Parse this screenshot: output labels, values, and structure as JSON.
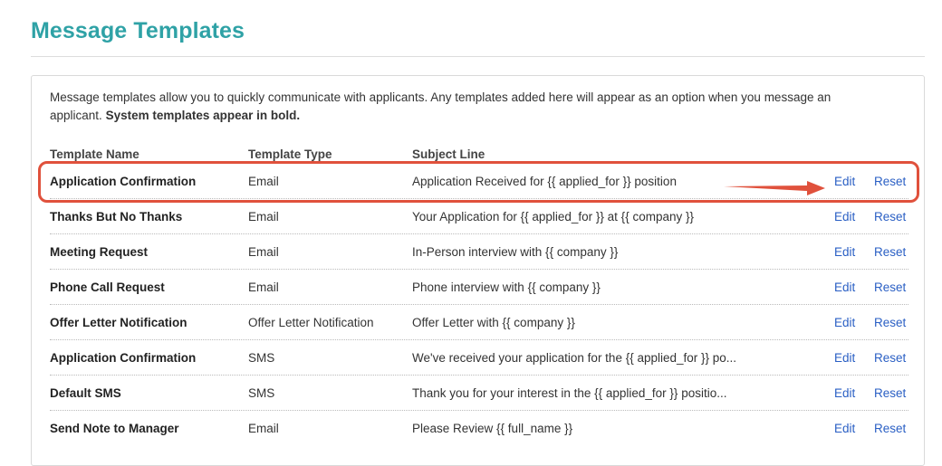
{
  "page": {
    "title": "Message Templates",
    "intro_text": "Message templates allow you to quickly communicate with applicants. Any templates added here will appear as an option when you message an applicant.",
    "intro_bold": "System templates appear in bold."
  },
  "table": {
    "headers": {
      "name": "Template Name",
      "type": "Template Type",
      "subject": "Subject Line"
    },
    "rows": [
      {
        "name": "Application Confirmation",
        "type": "Email",
        "subject": "Application Received for {{ applied_for }} position",
        "edit": "Edit",
        "reset": "Reset"
      },
      {
        "name": "Thanks But No Thanks",
        "type": "Email",
        "subject": "Your Application for {{ applied_for }} at {{ company }}",
        "edit": "Edit",
        "reset": "Reset"
      },
      {
        "name": "Meeting Request",
        "type": "Email",
        "subject": "In-Person interview with {{ company }}",
        "edit": "Edit",
        "reset": "Reset"
      },
      {
        "name": "Phone Call Request",
        "type": "Email",
        "subject": "Phone interview with {{ company }}",
        "edit": "Edit",
        "reset": "Reset"
      },
      {
        "name": "Offer Letter Notification",
        "type": "Offer Letter Notification",
        "subject": "Offer Letter with {{ company }}",
        "edit": "Edit",
        "reset": "Reset"
      },
      {
        "name": "Application Confirmation",
        "type": "SMS",
        "subject": "We've received your application for the {{ applied_for }} po...",
        "edit": "Edit",
        "reset": "Reset"
      },
      {
        "name": "Default SMS",
        "type": "SMS",
        "subject": "Thank you for your interest in the {{ applied_for }} positio...",
        "edit": "Edit",
        "reset": "Reset"
      },
      {
        "name": "Send Note to Manager",
        "type": "Email",
        "subject": "Please Review {{ full_name }}",
        "edit": "Edit",
        "reset": "Reset"
      }
    ]
  },
  "annotation": {
    "color": "#e0513c"
  },
  "colors": {
    "title": "#2fa2a6",
    "link": "#2a5fc4"
  }
}
